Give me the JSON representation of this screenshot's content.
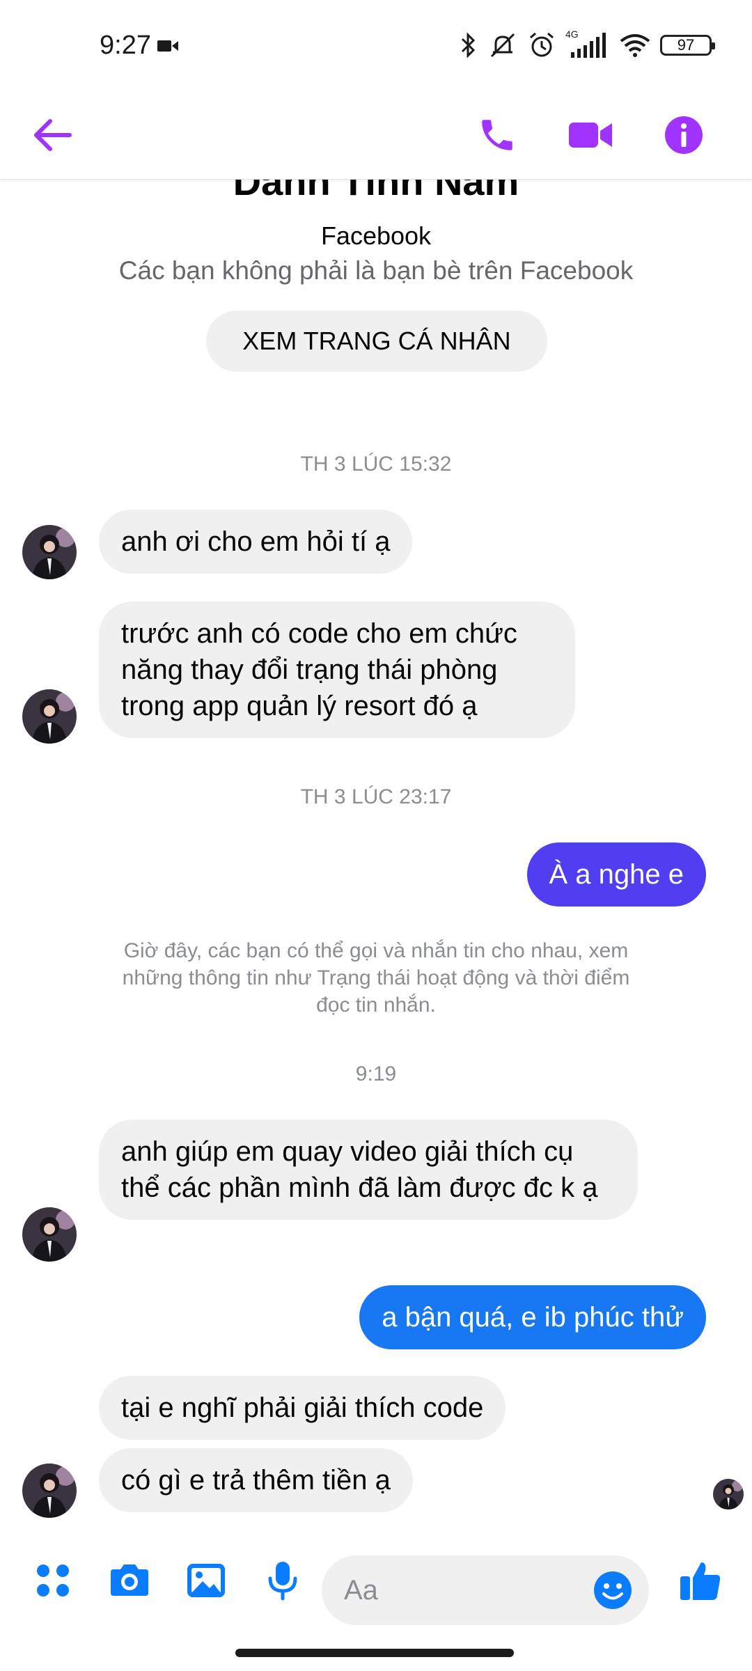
{
  "status_bar": {
    "time": "9:27",
    "network": "4G",
    "battery": "97"
  },
  "header": {
    "accent_color": "#a033ff",
    "icons": [
      "back-arrow-icon",
      "phone-icon",
      "video-camera-icon",
      "info-icon"
    ]
  },
  "profile": {
    "name_partial": "Danh Tính Nam",
    "platform": "Facebook",
    "relation_note": "Các bạn không phải là bạn bè trên Facebook",
    "view_profile_label": "XEM TRANG CÁ NHÂN"
  },
  "messages": {
    "ts1": "TH 3 LÚC 15:32",
    "m1": "anh ơi cho em hỏi tí ạ",
    "m2": "trước anh có code cho em chức năng thay đổi trạng thái phòng trong app quản lý resort đó ạ",
    "ts2": "TH 3 LÚC 23:17",
    "m3": "À a nghe e",
    "notice": "Giờ đây, các bạn có thể gọi và nhắn tin cho nhau, xem những thông tin như Trạng thái hoạt động và thời điểm đọc tin nhắn.",
    "ts3": "9:19",
    "m4": "anh giúp em quay video giải thích cụ thể các phần mình đã làm được đc k ạ",
    "m5": "a bận quá, e ib phúc thử",
    "m6": "tại e nghĩ phải giải thích code",
    "m7": "có gì e trả thêm tiền ạ"
  },
  "colors": {
    "outgoing_1": "#4f3ff0",
    "outgoing_2": "#1877f2",
    "incoming": "#f0f0f0",
    "composer_blue": "#0a7cff"
  },
  "composer": {
    "placeholder": "Aa",
    "icons": [
      "apps-icon",
      "camera-icon",
      "gallery-icon",
      "microphone-icon",
      "emoji-icon",
      "thumbs-up-icon"
    ]
  }
}
